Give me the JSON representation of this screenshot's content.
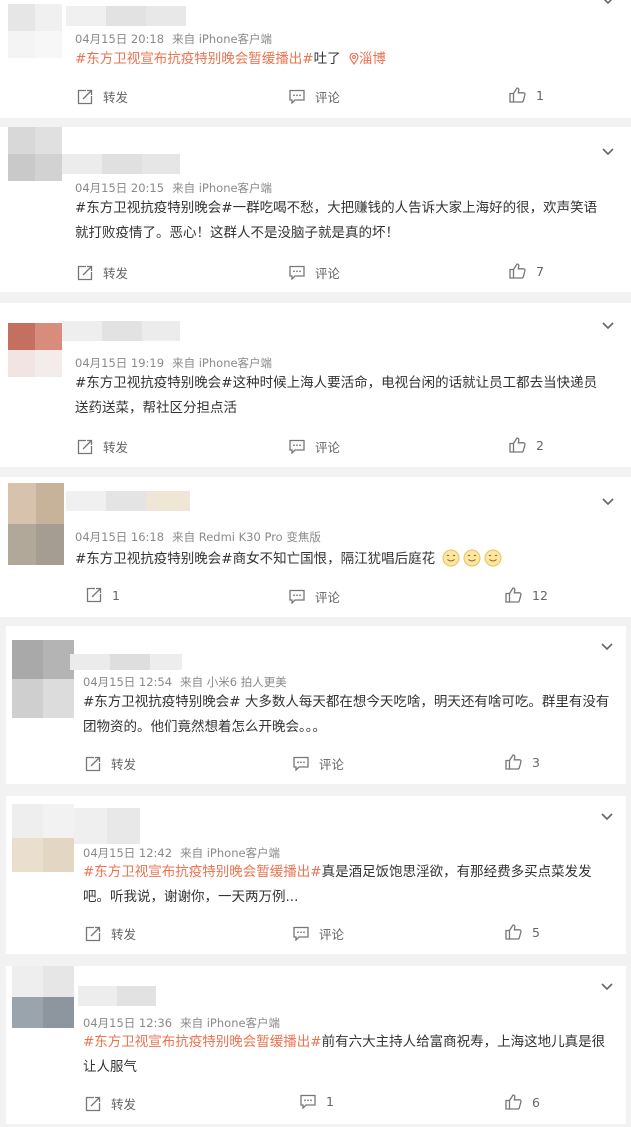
{
  "posts": [
    {
      "time": "04月15日 20:18",
      "source": "来自 iPhone客户端",
      "hashtag": "#东方卫视宣布抗疫特别晚会暂缓播出#",
      "text": "吐了",
      "location": "淄博",
      "repost": "转发",
      "comment": "评论",
      "likes": "1"
    },
    {
      "time": "04月15日 20:15",
      "source": "来自 iPhone客户端",
      "hashtag": "#东方卫视抗疫特别晚会#",
      "text_line1": "一群吃喝不愁，大把赚钱的人告诉大家上海好的很，欢声笑语",
      "text_line2": "就打败疫情了。恶心！这群人不是没脑子就是真的坏！",
      "repost": "转发",
      "comment": "评论",
      "likes": "7"
    },
    {
      "time": "04月15日 19:19",
      "source": "来自 iPhone客户端",
      "hashtag": "#东方卫视抗疫特别晚会#",
      "text_line1": "这种时候上海人要活命，电视台闲的话就让员工都去当快递员",
      "text_line2": "送药送菜，帮社区分担点活",
      "repost": "转发",
      "comment": "评论",
      "likes": "2"
    },
    {
      "time": "04月15日 16:18",
      "source": "来自 Redmi K30 Pro 变焦版",
      "hashtag": "#东方卫视抗疫特别晚会#",
      "text": "商女不知亡国恨，隔江犹唱后庭花",
      "repost": "1",
      "comment": "评论",
      "likes": "12"
    },
    {
      "time": "04月15日 12:54",
      "source": "来自 小米6 拍人更美",
      "hashtag": "#东方卫视抗疫特别晚会#",
      "text_line1": " 大多数人每天都在想今天吃啥，明天还有啥可吃。群里有没有",
      "text_line2": "团物资的。他们竟然想着怎么开晚会。。。",
      "repost": "转发",
      "comment": "评论",
      "likes": "3"
    },
    {
      "time": "04月15日 12:42",
      "source": "来自 iPhone客户端",
      "hashtag": "#东方卫视宣布抗疫特别晚会暂缓播出#",
      "text_line1": "真是酒足饭饱思淫欲，有那经费多买点菜发发",
      "text_line2": "吧。听我说，谢谢你，一天两万例...",
      "repost": "转发",
      "comment": "评论",
      "likes": "5"
    },
    {
      "time": "04月15日 12:36",
      "source": "来自 iPhone客户端",
      "hashtag": "#东方卫视宣布抗疫特别晚会暂缓播出#",
      "text_line1": "前有六大主持人给富商祝寿，上海这地儿真是很",
      "text_line2": "让人服气",
      "repost": "转发",
      "comment": "1",
      "likes": "6"
    }
  ],
  "colors": {
    "accent": "#eb7350",
    "meta": "#8a8a8a",
    "text": "#333333"
  },
  "icons": [
    "repost-icon",
    "comment-icon",
    "like-icon",
    "chevron-down-icon",
    "location-pin-icon",
    "smile-emoji-icon"
  ]
}
